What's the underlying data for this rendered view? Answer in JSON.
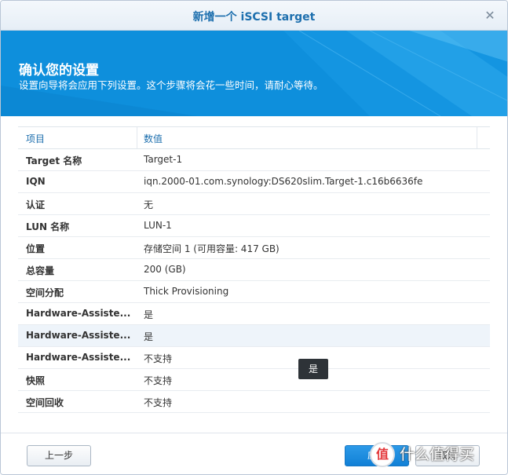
{
  "window": {
    "title": "新增一个 iSCSI target",
    "close_glyph": "✕"
  },
  "banner": {
    "title": "确认您的设置",
    "subtitle": "设置向导将会应用下列设置。这个步骤将会花一些时间，请耐心等待。"
  },
  "table": {
    "headers": [
      "项目",
      "数值"
    ],
    "rows": [
      {
        "key": "Target 名称",
        "value": "Target-1"
      },
      {
        "key": "IQN",
        "value": "iqn.2000-01.com.synology:DS620slim.Target-1.c16b6636fe"
      },
      {
        "key": "认证",
        "value": "无"
      },
      {
        "key": "LUN 名称",
        "value": "LUN-1"
      },
      {
        "key": "位置",
        "value": "存储空间 1 (可用容量: 417 GB)"
      },
      {
        "key": "总容量",
        "value": "200 (GB)"
      },
      {
        "key": "空间分配",
        "value": "Thick Provisioning"
      },
      {
        "key": "Hardware-Assiste...",
        "value": "是"
      },
      {
        "key": "Hardware-Assiste...",
        "value": "是"
      },
      {
        "key": "Hardware-Assiste...",
        "value": "不支持"
      },
      {
        "key": "快照",
        "value": "不支持"
      },
      {
        "key": "空间回收",
        "value": "不支持"
      }
    ],
    "highlighted_row": 8
  },
  "tooltip": {
    "text": "是"
  },
  "footer": {
    "prev_label": "上一步",
    "apply_label": "应用",
    "cancel_label": "取消"
  },
  "watermark": {
    "logo_glyph": "值",
    "text": "什么值得买"
  },
  "colors": {
    "accent": "#1d6fae",
    "banner": "#0e8fdc",
    "apply_button": "#1180d6"
  }
}
